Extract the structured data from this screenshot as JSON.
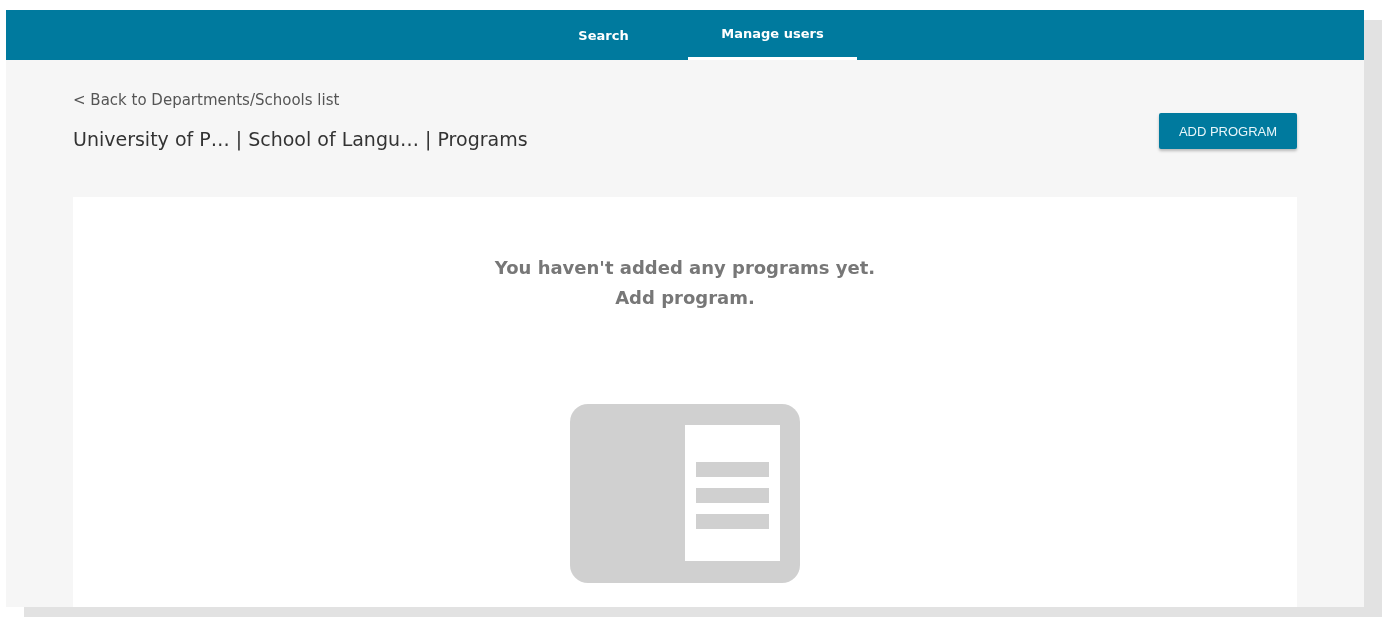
{
  "tabs": [
    {
      "label": "Search",
      "selected": false
    },
    {
      "label": "Manage users",
      "selected": true
    }
  ],
  "back_link": "< Back to Departments/Schools list",
  "breadcrumb": "University of P… | School of Langu… | Programs",
  "add_button": "ADD PROGRAM",
  "empty_state": {
    "message": "You haven't added any programs yet.",
    "hint": "Add program."
  }
}
